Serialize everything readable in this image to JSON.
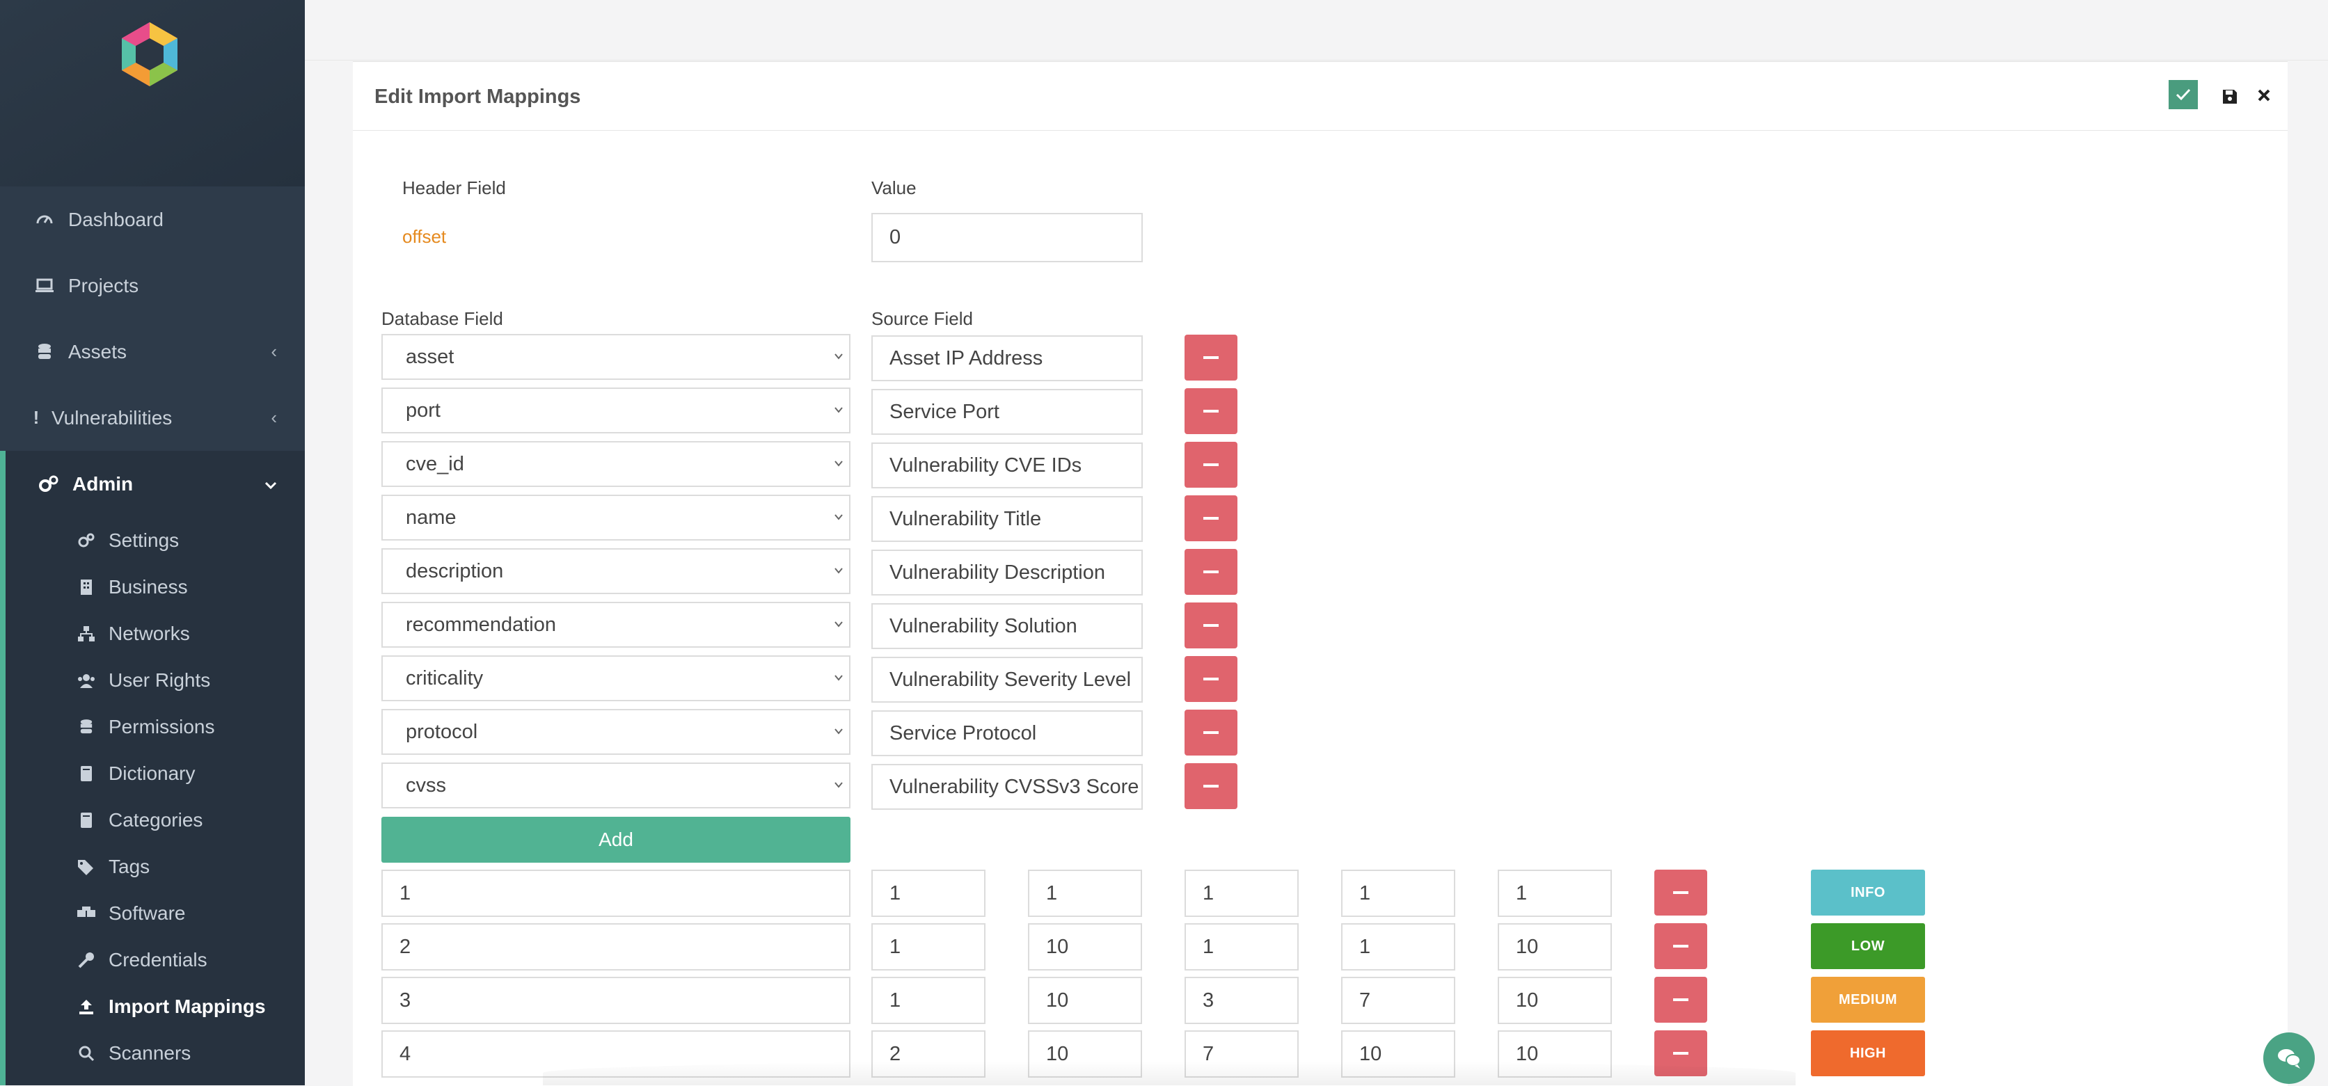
{
  "nav": {
    "items": [
      {
        "label": "Dashboard",
        "icon": "gauge-icon"
      },
      {
        "label": "Projects",
        "icon": "laptop-icon"
      },
      {
        "label": "Assets",
        "icon": "database-icon",
        "chevron": "‹"
      },
      {
        "label": "Vulnerabilities",
        "icon": "exclamation-icon",
        "chevron": "‹"
      }
    ],
    "admin": {
      "label": "Admin",
      "icon": "cogs-icon",
      "chevron": "⌄"
    },
    "admin_items": [
      {
        "label": "Settings",
        "icon": "cogs-icon"
      },
      {
        "label": "Business",
        "icon": "building-icon"
      },
      {
        "label": "Networks",
        "icon": "sitemap-icon"
      },
      {
        "label": "User Rights",
        "icon": "users-icon"
      },
      {
        "label": "Permissions",
        "icon": "database-icon"
      },
      {
        "label": "Dictionary",
        "icon": "book-icon"
      },
      {
        "label": "Categories",
        "icon": "book-icon"
      },
      {
        "label": "Tags",
        "icon": "tags-icon"
      },
      {
        "label": "Software",
        "icon": "boxes-icon"
      },
      {
        "label": "Credentials",
        "icon": "key-icon"
      },
      {
        "label": "Import Mappings",
        "icon": "upload-icon",
        "active": true
      },
      {
        "label": "Scanners",
        "icon": "search-icon"
      }
    ]
  },
  "card": {
    "title": "Edit Import Mappings"
  },
  "header_section": {
    "header_field_label": "Header Field",
    "value_label": "Value",
    "header_field": "offset",
    "value": "0"
  },
  "mapping_section": {
    "db_field_label": "Database Field",
    "source_field_label": "Source Field",
    "rows": [
      {
        "db": "asset",
        "source": "Asset IP Address"
      },
      {
        "db": "port",
        "source": "Service Port"
      },
      {
        "db": "cve_id",
        "source": "Vulnerability CVE IDs"
      },
      {
        "db": "name",
        "source": "Vulnerability Title"
      },
      {
        "db": "description",
        "source": "Vulnerability Description"
      },
      {
        "db": "recommendation",
        "source": "Vulnerability Solution"
      },
      {
        "db": "criticality",
        "source": "Vulnerability Severity Level"
      },
      {
        "db": "protocol",
        "source": "Service Protocol"
      },
      {
        "db": "cvss",
        "source": "Vulnerability CVSSv3 Score"
      }
    ],
    "add_label": "Add"
  },
  "criticality_rows": [
    {
      "a": "1",
      "b": "1",
      "c": "1",
      "d": "1",
      "e": "1",
      "f": "1",
      "badge": "INFO",
      "color": "#5bc0c9"
    },
    {
      "a": "2",
      "b": "1",
      "c": "10",
      "d": "1",
      "e": "1",
      "f": "10",
      "badge": "LOW",
      "color": "#3c9a28"
    },
    {
      "a": "3",
      "b": "1",
      "c": "10",
      "d": "3",
      "e": "7",
      "f": "10",
      "badge": "MEDIUM",
      "color": "#f0a039"
    },
    {
      "a": "4",
      "b": "2",
      "c": "10",
      "d": "7",
      "e": "10",
      "f": "10",
      "badge": "HIGH",
      "color": "#ef6a2d"
    }
  ],
  "colors": {
    "sidebar": "#2e3b4a",
    "accent": "#51b393",
    "danger": "#e0646d",
    "offset_text": "#e58a1f"
  }
}
